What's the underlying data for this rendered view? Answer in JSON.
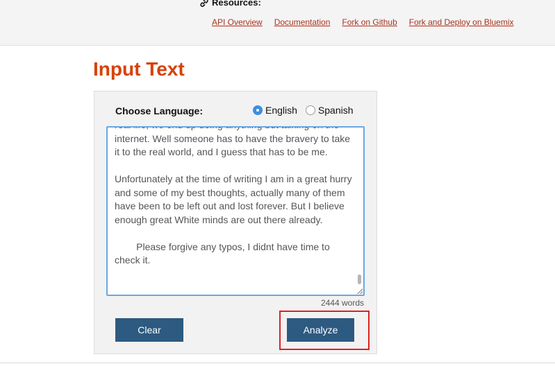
{
  "header": {
    "resources_label": "Resources:",
    "links": [
      {
        "label": "API Overview"
      },
      {
        "label": "Documentation"
      },
      {
        "label": "Fork on Github"
      },
      {
        "label": "Fork and Deploy on Bluemix"
      }
    ]
  },
  "main": {
    "title": "Input Text",
    "choose_language_label": "Choose Language:",
    "languages": [
      {
        "label": "English",
        "selected": true
      },
      {
        "label": "Spanish",
        "selected": false
      }
    ],
    "textarea_text": "real life, we end up doing anything but talking on the internet. Well someone has to have the bravery to take it to the real world, and I guess that has to be me.\n\nUnfortunately at the time of writing I am in a great hurry and some of my best thoughts, actually many of them have been to be left out and lost forever. But I believe enough great White minds are out there already.\n\n        Please forgive any typos, I didnt have time to check it. ",
    "word_count": "2444 words",
    "clear_label": "Clear",
    "analyze_label": "Analyze"
  },
  "colors": {
    "title": "#d74108",
    "link": "#a8331e",
    "button": "#2d5a80",
    "highlight": "#e02020",
    "focus_border": "#6aa7e4"
  }
}
